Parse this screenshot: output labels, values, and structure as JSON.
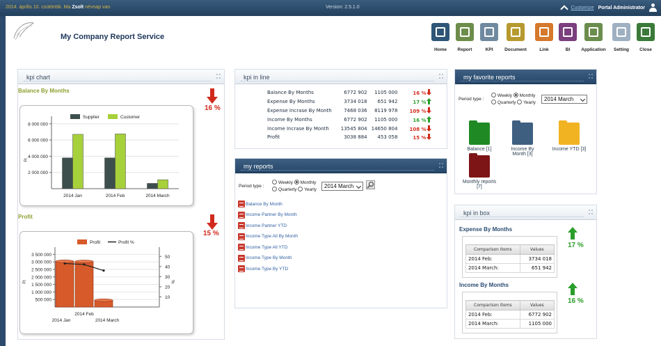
{
  "topbar": {
    "date": "2014. április 10. csütörtök. Ma",
    "user_name": "Zsolt",
    "nameday": "névnap van",
    "version": "Version: 2.5.1.0",
    "customize": "Customize",
    "admin": "Portal Administrator"
  },
  "header": {
    "title": "My Company Report Service",
    "nav": [
      {
        "label": "Home",
        "icon": "home-icon",
        "color": "#2d5577"
      },
      {
        "label": "Report",
        "icon": "report-icon",
        "color": "#6d8d4a"
      },
      {
        "label": "KPI",
        "icon": "kpi-icon",
        "color": "#6f8aa0"
      },
      {
        "label": "Document",
        "icon": "document-icon",
        "color": "#b79a2f"
      },
      {
        "label": "Link",
        "icon": "link-icon",
        "color": "#d6792b"
      },
      {
        "label": "BI",
        "icon": "bi-icon",
        "color": "#7b3e7e"
      },
      {
        "label": "Application",
        "icon": "application-icon",
        "color": "#6a8d4d"
      },
      {
        "label": "Setting",
        "icon": "setting-icon",
        "color": "#9fb0c1"
      },
      {
        "label": "Close",
        "icon": "close-icon",
        "color": "#3b7a39"
      }
    ]
  },
  "kpi_chart": {
    "title": "kpi chart",
    "balance_title": "Balance By Months",
    "balance_pct": "16 %",
    "profit_title": "Profit",
    "profit_pct": "15 %"
  },
  "chart_data": [
    {
      "type": "bar",
      "title": "Balance By Months",
      "categories": [
        "2014 Jan",
        "2014 Feb",
        "2014 March"
      ],
      "series": [
        {
          "name": "Supplier",
          "values": [
            3800000,
            3800000,
            650000
          ],
          "color": "#3d4f4c"
        },
        {
          "name": "Customer",
          "values": [
            6700000,
            6750000,
            1100000
          ],
          "color": "#a7d13a"
        }
      ],
      "yticks": [
        "8 000 000",
        "6 000 000",
        "4 000 000",
        "2 000 000"
      ],
      "ytick_values": [
        8000000,
        6000000,
        4000000,
        2000000
      ],
      "ylabel": "Ft",
      "ylim": [
        0,
        8500000
      ],
      "legend": "top"
    },
    {
      "type": "bar",
      "title": "Profit",
      "categories": [
        "2014 Jan",
        "2014 Feb",
        "2014 March"
      ],
      "xtick_labels": [
        "2014 Jan",
        "2014 Feb",
        "2014 March"
      ],
      "series": [
        {
          "name": "Profit",
          "values": [
            3038884,
            3030000,
            453058
          ],
          "color": "#d65a2a"
        },
        {
          "name": "Profit %",
          "values": [
            43,
            42,
            36
          ],
          "color": "#222222",
          "axis": "right"
        }
      ],
      "yticks": [
        "3 500 000",
        "3 000 000",
        "2 500 000",
        "2 000 000",
        "1 500 000",
        "1 000 000",
        "500 000"
      ],
      "ytick_values": [
        3500000,
        3000000,
        2500000,
        2000000,
        1500000,
        1000000,
        500000
      ],
      "y2ticks": [
        "50",
        "40",
        "30",
        "20",
        "10"
      ],
      "y2tick_values": [
        50,
        40,
        30,
        20,
        10
      ],
      "ylabel": "Ft",
      "y2label": "%",
      "ylim": [
        0,
        3700000
      ],
      "y2lim": [
        0,
        55
      ],
      "legend": "top"
    }
  ],
  "kpi_line": {
    "title": "kpi in line",
    "rows": [
      {
        "name": "Balance By Months",
        "v1": "6772 902",
        "v2": "1105 000",
        "pct": "16 %",
        "dir": "down"
      },
      {
        "name": "Expense By Months",
        "v1": "3734 018",
        "v2": "651 942",
        "pct": "17 %",
        "dir": "up"
      },
      {
        "name": "Expense Incrase By Month",
        "v1": "7468 036",
        "v2": "8119 978",
        "pct": "109 %",
        "dir": "down"
      },
      {
        "name": "Income By Months",
        "v1": "6772 902",
        "v2": "1105 000",
        "pct": "16 %",
        "dir": "up"
      },
      {
        "name": "Income Incrase By Month",
        "v1": "13545 804",
        "v2": "14650 804",
        "pct": "108 %",
        "dir": "down"
      },
      {
        "name": "Profit",
        "v1": "3038 884",
        "v2": "453 058",
        "pct": "15 %",
        "dir": "down"
      }
    ]
  },
  "my_reports": {
    "title": "my reports",
    "period_label": "Period type :",
    "options": [
      "Weekly",
      "Monthly",
      "Quarterly",
      "Yearly"
    ],
    "selected": "Monthly",
    "month": "2014 March",
    "items": [
      "Balance By Month",
      "Income Partner By Month",
      "Income Partner YTD",
      "Income Type All By Month",
      "Income Type All YTD",
      "Income Type By Month",
      "Income Type By YTD"
    ]
  },
  "favorites": {
    "title": "my favorite reports",
    "period_label": "Period type :",
    "options": [
      "Weekly",
      "Monthly",
      "Quarterly",
      "Yearly"
    ],
    "selected": "Monthly",
    "month": "2014 March",
    "folders": [
      {
        "label": "Balance [1]",
        "color": "#1f8a24"
      },
      {
        "label": "Income By Month [3]",
        "color": "#3e5f80"
      },
      {
        "label": "Income YTD [3]",
        "color": "#f2b323"
      },
      {
        "label": "Monthly reports [7]",
        "color": "#7d1416"
      }
    ]
  },
  "kpi_box": {
    "title": "kpi in box",
    "col1": "Comparison Items",
    "col2": "Values",
    "boxes": [
      {
        "title": "Expense By Months",
        "pct": "17 %",
        "rows": [
          {
            "item": "2014 Feb:",
            "value": "3734 018"
          },
          {
            "item": "2014 March:",
            "value": "651 942"
          }
        ]
      },
      {
        "title": "Income By Months",
        "pct": "16 %",
        "rows": [
          {
            "item": "2014 Feb:",
            "value": "6772 902"
          },
          {
            "item": "2014 March:",
            "value": "1105 000"
          }
        ]
      }
    ]
  }
}
